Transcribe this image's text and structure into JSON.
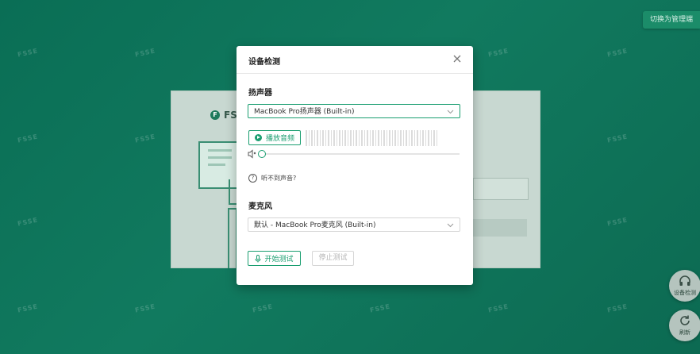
{
  "watermark_text": "FSSE",
  "admin_button": "切换为管理端",
  "background": {
    "logo_initial": "F",
    "logo_text": "FSS"
  },
  "floating_buttons": [
    {
      "label": "设备检测",
      "icon": "headphones-icon"
    },
    {
      "label": "刷新",
      "icon": "refresh-icon"
    }
  ],
  "dialog": {
    "title": "设备检测",
    "speaker": {
      "section_title": "扬声器",
      "selected_device": "MacBook Pro扬声器 (Built-in)",
      "play_button": "播放音频",
      "volume_level": 0,
      "help_text": "听不到声音?"
    },
    "microphone": {
      "section_title": "麦克风",
      "selected_device": "默认 - MacBook Pro麦克风 (Built-in)",
      "start_button": "开始测试",
      "stop_button": "停止测试"
    }
  },
  "colors": {
    "accent": "#1a9e70",
    "background": "#0f7459"
  }
}
